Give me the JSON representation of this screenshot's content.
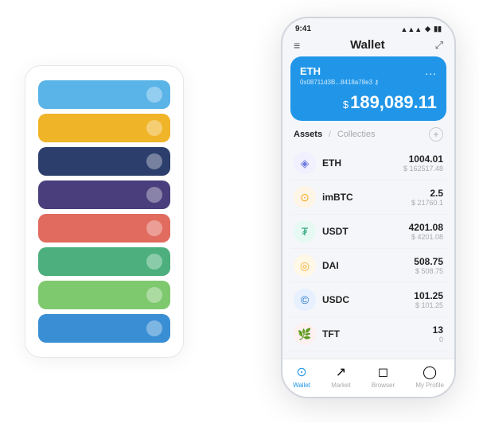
{
  "scene": {
    "background": "#ffffff"
  },
  "cardStack": {
    "cards": [
      {
        "color": "#5ab4e8",
        "dotColor": "rgba(255,255,255,0.35)"
      },
      {
        "color": "#f0b429",
        "dotColor": "rgba(255,255,255,0.35)"
      },
      {
        "color": "#2c3e6b",
        "dotColor": "rgba(255,255,255,0.35)"
      },
      {
        "color": "#4a3f7c",
        "dotColor": "rgba(255,255,255,0.35)"
      },
      {
        "color": "#e06b5e",
        "dotColor": "rgba(255,255,255,0.35)"
      },
      {
        "color": "#4caf7d",
        "dotColor": "rgba(255,255,255,0.35)"
      },
      {
        "color": "#7ec86e",
        "dotColor": "rgba(255,255,255,0.35)"
      },
      {
        "color": "#3a8fd4",
        "dotColor": "rgba(255,255,255,0.35)"
      }
    ]
  },
  "phone": {
    "statusBar": {
      "time": "9:41",
      "icons": "▲ ◆ ▮"
    },
    "header": {
      "menuIcon": "≡",
      "title": "Wallet",
      "expandIcon": "⤢"
    },
    "ethCard": {
      "label": "ETH",
      "dotsLabel": "...",
      "address": "0x08711d3B...8418a78e3 ⚷",
      "balanceSymbol": "$",
      "balance": "189,089.11"
    },
    "assetsSection": {
      "activeTab": "Assets",
      "divider": "/",
      "inactiveTab": "Collecties",
      "addLabel": "+"
    },
    "assets": [
      {
        "name": "ETH",
        "iconEmoji": "◈",
        "iconBg": "#f0f0ff",
        "iconColor": "#6c7ae0",
        "amount": "1004.01",
        "value": "$ 162517.48"
      },
      {
        "name": "imBTC",
        "iconEmoji": "⊙",
        "iconBg": "#fff5e6",
        "iconColor": "#f5a623",
        "amount": "2.5",
        "value": "$ 21760.1"
      },
      {
        "name": "USDT",
        "iconEmoji": "₮",
        "iconBg": "#e6f9f2",
        "iconColor": "#26a17b",
        "amount": "4201.08",
        "value": "$ 4201.08"
      },
      {
        "name": "DAI",
        "iconEmoji": "◎",
        "iconBg": "#fff8e6",
        "iconColor": "#f5ac37",
        "amount": "508.75",
        "value": "$ 508.75"
      },
      {
        "name": "USDC",
        "iconEmoji": "©",
        "iconBg": "#e6f0ff",
        "iconColor": "#2775ca",
        "amount": "101.25",
        "value": "$ 101.25"
      },
      {
        "name": "TFT",
        "iconEmoji": "🌿",
        "iconBg": "#fff0f0",
        "iconColor": "#e05a7a",
        "amount": "13",
        "value": "0"
      }
    ],
    "bottomNav": [
      {
        "label": "Wallet",
        "icon": "⊙",
        "active": true
      },
      {
        "label": "Market",
        "icon": "↗",
        "active": false
      },
      {
        "label": "Browser",
        "icon": "◻",
        "active": false
      },
      {
        "label": "My Profile",
        "icon": "◯",
        "active": false
      }
    ]
  }
}
